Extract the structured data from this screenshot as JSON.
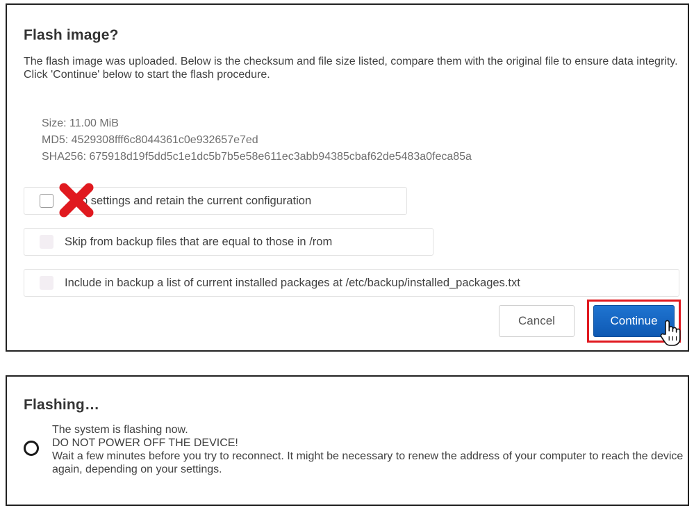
{
  "flash_dialog": {
    "title": "Flash image?",
    "description_line1": "The flash image was uploaded. Below is the checksum and file size listed, compare them with the original file to ensure data integrity.",
    "description_line2": "Click 'Continue' below to start the flash procedure.",
    "size": "Size: 11.00 MiB",
    "md5": "MD5: 4529308fff6c8044361c0e932657e7ed",
    "sha256": "SHA256: 675918d19f5dd5c1e1dc5b7b5e58e611ec3abb94385cbaf62de5483a0feca85a",
    "options": {
      "keep_settings": "p settings and retain the current configuration",
      "skip_backup": "Skip from backup files that are equal to those in /rom",
      "include_packages": "Include in backup a list of current installed packages at /etc/backup/installed_packages.txt"
    },
    "cancel_label": "Cancel",
    "continue_label": "Continue",
    "colors": {
      "annotation_red": "#e0191f",
      "primary_blue": "#1565c0"
    }
  },
  "flashing_dialog": {
    "title": "Flashing…",
    "line1": "The system is flashing now.",
    "line2": "DO NOT POWER OFF THE DEVICE!",
    "line3": "Wait a few minutes before you try to reconnect. It might be necessary to renew the address of your computer to reach the device again, depending on your settings."
  },
  "icons": {
    "cross": "cross-mark-icon",
    "cursor": "hand-pointer-icon",
    "spinner": "loading-spinner-icon"
  }
}
